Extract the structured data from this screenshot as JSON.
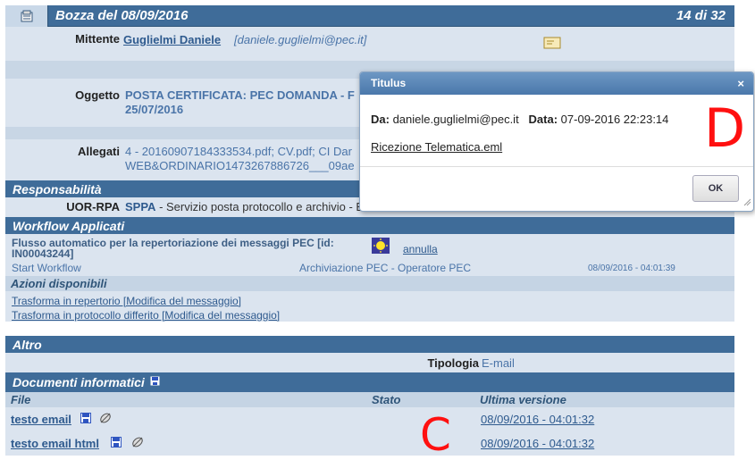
{
  "header": {
    "title": "Bozza del 08/09/2016",
    "pager": "14 di 32"
  },
  "mittente": {
    "label": "Mittente",
    "name": "Guglielmi Daniele",
    "email": "[daniele.guglielmi@pec.it]"
  },
  "oggetto": {
    "label": "Oggetto",
    "line1": "POSTA CERTIFICATA: PEC DOMANDA - F",
    "line2": "25/07/2016"
  },
  "allegati": {
    "label": "Allegati",
    "line1": "4 - 20160907184333534.pdf; CV.pdf; CI Dar",
    "line2": "WEB&ORDINARIO1473267886726___09ae"
  },
  "responsabilita": {
    "title": "Responsabilità",
    "label": "UOR-RPA",
    "code": "SPPA",
    "value": "- Servizio posta protocollo e archivio - B"
  },
  "workflow": {
    "title": "Workflow Applicati",
    "flow_title": "Flusso automatico per la repertoriazione dei messaggi PEC [id: IN00043244]",
    "annulla": "annulla",
    "start": "Start Workflow",
    "archive": "Archiviazione PEC - Operatore PEC",
    "date": "08/09/2016 - 04:01:39",
    "azioni_title": "Azioni disponibili",
    "azione1": "Trasforma in repertorio [Modifica del messaggio]",
    "azione2": "Trasforma in protocollo differito [Modifica del messaggio]"
  },
  "altro": {
    "title": "Altro",
    "tipologia_label": "Tipologia",
    "tipologia_value": "E-mail"
  },
  "documenti": {
    "title": "Documenti informatici",
    "col_file": "File",
    "col_stato": "Stato",
    "col_versione": "Ultima versione",
    "rows": [
      {
        "name": "testo email",
        "version": "08/09/2016 - 04:01:32"
      },
      {
        "name": "testo email html",
        "version": "08/09/2016 - 04:01:32"
      }
    ]
  },
  "dialog": {
    "title": "Titulus",
    "close": "×",
    "da_label": "Da:",
    "da_value": "daniele.guglielmi@pec.it",
    "data_label": "Data:",
    "data_value": "07-09-2016 22:23:14",
    "attachment": "Ricezione Telematica.eml",
    "ok": "OK"
  },
  "annotations": {
    "d": "D",
    "c": "C"
  },
  "colors": {
    "header": "#3f6c99",
    "panel": "#dbe4ef",
    "annotation": "#ff1010"
  }
}
